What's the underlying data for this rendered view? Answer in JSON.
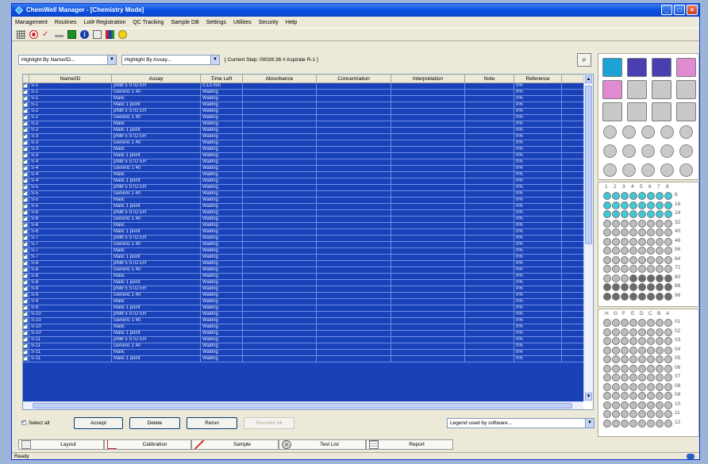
{
  "window": {
    "title": "ChemWell Manager - [Chemistry Mode]",
    "min_glyph": "_",
    "max_glyph": "□",
    "close_glyph": "×"
  },
  "menu": [
    "Management",
    "Routines",
    "Lot# Registration",
    "QC Tracking",
    "Sample DB",
    "Settings",
    "Utilities",
    "Security",
    "Help"
  ],
  "toolbar_icons": [
    "grid-icon",
    "target-icon",
    "check-mark-icon",
    "minus-icon",
    "green-square-icon",
    "info-icon",
    "report-icon",
    "bar-chart-icon",
    "smiley-icon"
  ],
  "filters": {
    "highlight_name": "Highlight By Name/ID...",
    "highlight_assay": "Highlight By Assay...",
    "current_step": "[ Current Step: 00026:36 # Aspirate R-1 ]"
  },
  "grid": {
    "columns": [
      "",
      "Name/ID",
      "Assay",
      "Time Left",
      "Absorbance",
      "Concentration",
      "Interpretation",
      "Note",
      "Reference"
    ],
    "rows": [
      {
        "id": "S-1",
        "assay": "pNM 5 STD ER",
        "time": "0:13 min",
        "ref": "0%"
      },
      {
        "id": "S-1",
        "assay": "Generic 1 40",
        "time": "Waiting",
        "ref": "0%"
      },
      {
        "id": "S-1",
        "assay": "Malic",
        "time": "Waiting",
        "ref": "0%"
      },
      {
        "id": "S-1",
        "assay": "Malic 1 point",
        "time": "Waiting",
        "ref": "0%"
      },
      {
        "id": "S-2",
        "assay": "pNM 5 STD ER",
        "time": "Waiting",
        "ref": "0%"
      },
      {
        "id": "S-2",
        "assay": "Generic 1 40",
        "time": "Waiting",
        "ref": "0%"
      },
      {
        "id": "S-2",
        "assay": "Malic",
        "time": "Waiting",
        "ref": "0%"
      },
      {
        "id": "S-2",
        "assay": "Malic 1 point",
        "time": "Waiting",
        "ref": "0%"
      },
      {
        "id": "S-3",
        "assay": "pNM 5 STD ER",
        "time": "Waiting",
        "ref": "0%"
      },
      {
        "id": "S-3",
        "assay": "Generic 1 40",
        "time": "Waiting",
        "ref": "0%"
      },
      {
        "id": "S-3",
        "assay": "Malic",
        "time": "Waiting",
        "ref": "0%"
      },
      {
        "id": "S-3",
        "assay": "Malic 1 point",
        "time": "Waiting",
        "ref": "0%"
      },
      {
        "id": "S-4",
        "assay": "pNM 5 STD ER",
        "time": "Waiting",
        "ref": "0%"
      },
      {
        "id": "S-4",
        "assay": "Generic 1 40",
        "time": "Waiting",
        "ref": "0%"
      },
      {
        "id": "S-4",
        "assay": "Malic",
        "time": "Waiting",
        "ref": "0%"
      },
      {
        "id": "S-4",
        "assay": "Malic 1 point",
        "time": "Waiting",
        "ref": "0%"
      },
      {
        "id": "S-5",
        "assay": "pNM 5 STD ER",
        "time": "Waiting",
        "ref": "0%"
      },
      {
        "id": "S-5",
        "assay": "Generic 1 40",
        "time": "Waiting",
        "ref": "0%"
      },
      {
        "id": "S-5",
        "assay": "Malic",
        "time": "Waiting",
        "ref": "0%"
      },
      {
        "id": "S-5",
        "assay": "Malic 1 point",
        "time": "Waiting",
        "ref": "0%"
      },
      {
        "id": "S-6",
        "assay": "pNM 5 STD ER",
        "time": "Waiting",
        "ref": "0%"
      },
      {
        "id": "S-6",
        "assay": "Generic 1 40",
        "time": "Waiting",
        "ref": "0%"
      },
      {
        "id": "S-6",
        "assay": "Malic",
        "time": "Waiting",
        "ref": "0%"
      },
      {
        "id": "S-6",
        "assay": "Malic 1 point",
        "time": "Waiting",
        "ref": "0%"
      },
      {
        "id": "S-7",
        "assay": "pNM 5 STD ER",
        "time": "Waiting",
        "ref": "0%"
      },
      {
        "id": "S-7",
        "assay": "Generic 1 40",
        "time": "Waiting",
        "ref": "0%"
      },
      {
        "id": "S-7",
        "assay": "Malic",
        "time": "Waiting",
        "ref": "0%"
      },
      {
        "id": "S-7",
        "assay": "Malic 1 point",
        "time": "Waiting",
        "ref": "0%"
      },
      {
        "id": "S-8",
        "assay": "pNM 5 STD ER",
        "time": "Waiting",
        "ref": "0%"
      },
      {
        "id": "S-8",
        "assay": "Generic 1 40",
        "time": "Waiting",
        "ref": "0%"
      },
      {
        "id": "S-8",
        "assay": "Malic",
        "time": "Waiting",
        "ref": "0%"
      },
      {
        "id": "S-8",
        "assay": "Malic 1 point",
        "time": "Waiting",
        "ref": "0%"
      },
      {
        "id": "S-9",
        "assay": "pNM 5 STD ER",
        "time": "Waiting",
        "ref": "0%"
      },
      {
        "id": "S-9",
        "assay": "Generic 1 40",
        "time": "Waiting",
        "ref": "0%"
      },
      {
        "id": "S-9",
        "assay": "Malic",
        "time": "Waiting",
        "ref": "0%"
      },
      {
        "id": "S-9",
        "assay": "Malic 1 point",
        "time": "Waiting",
        "ref": "0%"
      },
      {
        "id": "S-10",
        "assay": "pNM 5 STD ER",
        "time": "Waiting",
        "ref": "0%"
      },
      {
        "id": "S-10",
        "assay": "Generic 1 40",
        "time": "Waiting",
        "ref": "0%"
      },
      {
        "id": "S-10",
        "assay": "Malic",
        "time": "Waiting",
        "ref": "0%"
      },
      {
        "id": "S-10",
        "assay": "Malic 1 point",
        "time": "Waiting",
        "ref": "0%"
      },
      {
        "id": "S-11",
        "assay": "pNM 5 STD ER",
        "time": "Waiting",
        "ref": "0%"
      },
      {
        "id": "S-11",
        "assay": "Generic 1 40",
        "time": "Waiting",
        "ref": "0%"
      },
      {
        "id": "S-11",
        "assay": "Malic",
        "time": "Waiting",
        "ref": "0%"
      },
      {
        "id": "S-11",
        "assay": "Malic 1 point",
        "time": "Waiting",
        "ref": "0%"
      }
    ]
  },
  "bottom": {
    "select_all": "Select all",
    "accept": "Accept",
    "delete": "Delete",
    "rerun": "Rerun",
    "recover_all": "Recover All",
    "legend": "Legend used by software..."
  },
  "tabs": [
    {
      "label": "Layout",
      "icon": "layout-icon"
    },
    {
      "label": "Calibration",
      "icon": "calibration-curve-icon"
    },
    {
      "label": "Sample",
      "icon": "pipette-icon"
    },
    {
      "label": "Test List",
      "icon": "test-list-icon"
    },
    {
      "label": "Report",
      "icon": "report-page-icon"
    }
  ],
  "status": {
    "text": "Ready"
  },
  "colors": {
    "row_bg": "#1941b8",
    "reagent_cyan": "#1ba3d6",
    "reagent_purple": "#4a3fb0",
    "reagent_pink": "#e08ad2",
    "well_cyan": "#3ec9d6",
    "well_gray": "#bdbdbd",
    "well_dark": "#6a6a6a"
  },
  "plate1": {
    "col_labels": [
      "1",
      "2",
      "3",
      "4",
      "5",
      "6",
      "7",
      "8"
    ],
    "row_labels": [
      "8",
      "16",
      "24",
      "32",
      "40",
      "48",
      "56",
      "64",
      "72",
      "80",
      "88",
      "96"
    ]
  },
  "plate2": {
    "col_labels": [
      "H",
      "G",
      "F",
      "E",
      "D",
      "C",
      "B",
      "A"
    ],
    "row_labels": [
      "01",
      "02",
      "03",
      "04",
      "05",
      "06",
      "07",
      "08",
      "09",
      "10",
      "11",
      "12"
    ]
  }
}
